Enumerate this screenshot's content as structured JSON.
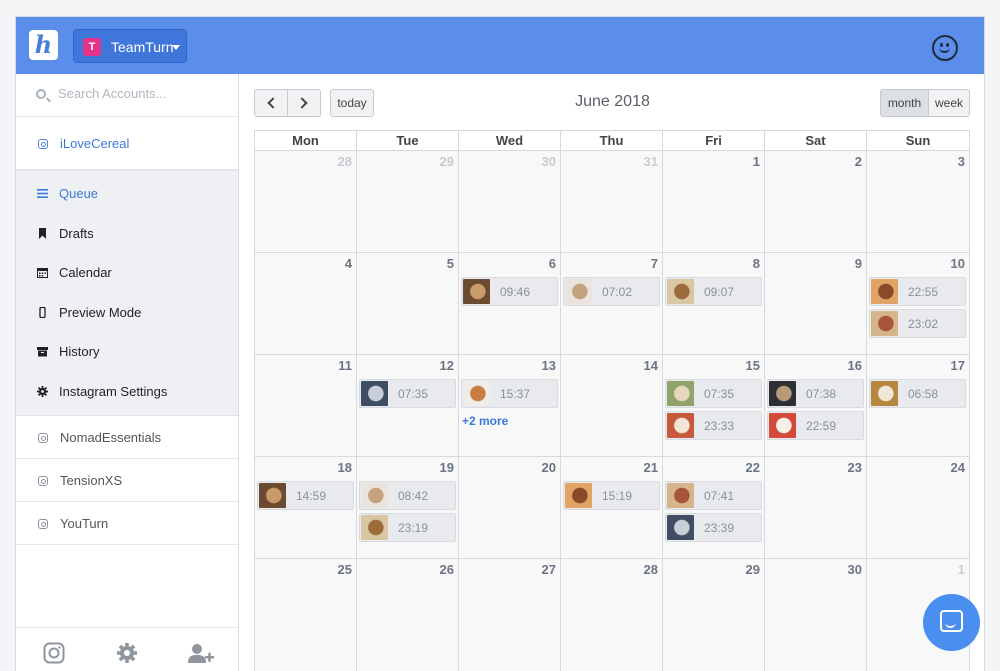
{
  "topbar": {
    "logo": "h",
    "team": {
      "initial": "T",
      "name": "TeamTurn"
    }
  },
  "search": {
    "placeholder": "Search Accounts..."
  },
  "accounts": {
    "active": "iLoveCereal",
    "others": [
      "NomadEssentials",
      "TensionXS",
      "YouTurn"
    ]
  },
  "menu": [
    "Queue",
    "Drafts",
    "Calendar",
    "Preview Mode",
    "History",
    "Instagram Settings"
  ],
  "toolbar": {
    "today": "today",
    "month": "month",
    "week": "week",
    "title": "June 2018"
  },
  "calendar": {
    "days_of_week": [
      "Mon",
      "Tue",
      "Wed",
      "Thu",
      "Fri",
      "Sat",
      "Sun"
    ],
    "weeks": [
      [
        "28",
        "29",
        "30",
        "31",
        "1",
        "2",
        "3"
      ],
      [
        "4",
        "5",
        "6",
        "7",
        "8",
        "9",
        "10"
      ],
      [
        "11",
        "12",
        "13",
        "14",
        "15",
        "16",
        "17"
      ],
      [
        "18",
        "19",
        "20",
        "21",
        "22",
        "23",
        "24"
      ],
      [
        "25",
        "26",
        "27",
        "28",
        "29",
        "30",
        "1"
      ]
    ],
    "events": {
      "1-2": [
        "09:46"
      ],
      "1-3": [
        "07:02"
      ],
      "1-4": [
        "09:07"
      ],
      "1-6": [
        "22:55",
        "23:02"
      ],
      "2-1": [
        "07:35"
      ],
      "2-2": [
        "15:37"
      ],
      "2-4": [
        "07:35",
        "23:33"
      ],
      "2-5": [
        "07:38",
        "22:59"
      ],
      "2-6": [
        "06:58"
      ],
      "3-0": [
        "14:59"
      ],
      "3-1": [
        "08:42",
        "23:19"
      ],
      "3-3": [
        "15:19"
      ],
      "3-4": [
        "07:41",
        "23:39"
      ]
    },
    "more": {
      "2-2": "+2 more"
    }
  },
  "colors": {
    "accent": "#5b8eea",
    "link": "#3b7ad4",
    "chat": "#4a8ff0"
  }
}
